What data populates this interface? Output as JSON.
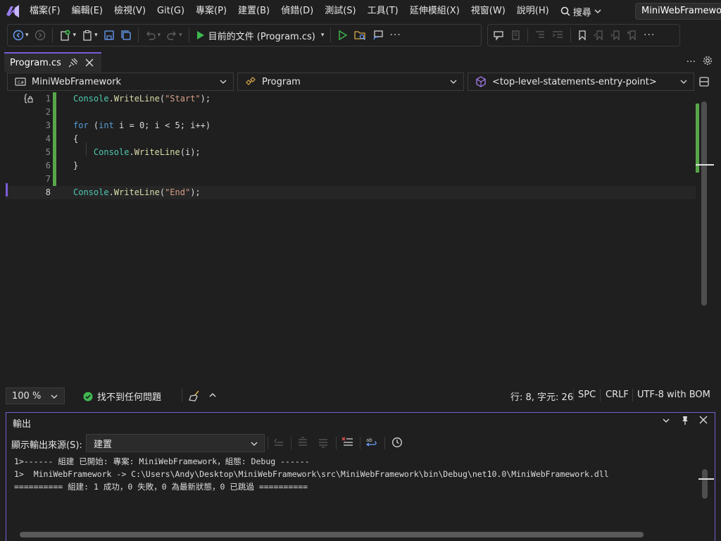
{
  "menu": {
    "items": [
      "檔案(F)",
      "編輯(E)",
      "檢視(V)",
      "Git(G)",
      "專案(P)",
      "建置(B)",
      "偵錯(D)",
      "測試(S)",
      "工具(T)",
      "延伸模組(X)",
      "視窗(W)",
      "說明(H)"
    ],
    "search_label": "搜尋",
    "solution_name": "MiniWebFramework"
  },
  "toolbar": {
    "run_target_label": "目前的文件 (Program.cs)"
  },
  "tabs": [
    {
      "label": "Program.cs",
      "active": true,
      "pinned": true
    }
  ],
  "navbar": {
    "project": "MiniWebFramework",
    "type": "Program",
    "member": "<top-level-statements-entry-point>"
  },
  "code": {
    "current_line": 8,
    "lines": [
      {
        "n": "1",
        "tokens": [
          [
            "cls",
            "Console"
          ],
          [
            "plain",
            "."
          ],
          [
            "mth",
            "WriteLine"
          ],
          [
            "plain",
            "("
          ],
          [
            "str",
            "\"Start\""
          ],
          [
            "plain",
            ");"
          ]
        ]
      },
      {
        "n": "2",
        "tokens": []
      },
      {
        "n": "3",
        "tokens": [
          [
            "kw",
            "for"
          ],
          [
            "plain",
            " ("
          ],
          [
            "kw",
            "int"
          ],
          [
            "plain",
            " i = 0; i < 5; i++)"
          ]
        ]
      },
      {
        "n": "4",
        "tokens": [
          [
            "plain",
            "{"
          ]
        ]
      },
      {
        "n": "5",
        "tokens": [
          [
            "plain",
            "    "
          ],
          [
            "cls",
            "Console"
          ],
          [
            "plain",
            "."
          ],
          [
            "mth",
            "WriteLine"
          ],
          [
            "plain",
            "(i);"
          ]
        ]
      },
      {
        "n": "6",
        "tokens": [
          [
            "plain",
            "}"
          ]
        ]
      },
      {
        "n": "7",
        "tokens": []
      },
      {
        "n": "8",
        "tokens": [
          [
            "cls",
            "Console"
          ],
          [
            "plain",
            "."
          ],
          [
            "mth",
            "WriteLine"
          ],
          [
            "plain",
            "("
          ],
          [
            "str",
            "\"End\""
          ],
          [
            "plain",
            ");"
          ]
        ]
      }
    ]
  },
  "editor_status": {
    "zoom": "100 %",
    "issues": "找不到任何問題",
    "position": "行: 8, 字元: 26",
    "whitespace": "SPC",
    "line_endings": "CRLF",
    "encoding": "UTF-8 with BOM"
  },
  "output": {
    "title": "輸出",
    "show_from_label": "顯示輸出來源(S):",
    "source": "建置",
    "lines": [
      "1>------ 組建 已開始: 專案: MiniWebFramework，組態: Debug ------",
      "1>  MiniWebFramework -> C:\\Users\\Andy\\Desktop\\MiniWebFramework\\src\\MiniWebFramework\\bin\\Debug\\net10.0\\MiniWebFramework.dll",
      "========== 組建: 1 成功，0 失敗，0 為最新狀態，0 已跳過 =========="
    ]
  },
  "colors": {
    "accent": "#7a5cd6",
    "change_bar": "#57a64a",
    "keyword": "#569cd6",
    "class": "#4ec9b0",
    "string": "#d69d85",
    "method": "#dcdcaa",
    "run_green": "#3fb950"
  }
}
